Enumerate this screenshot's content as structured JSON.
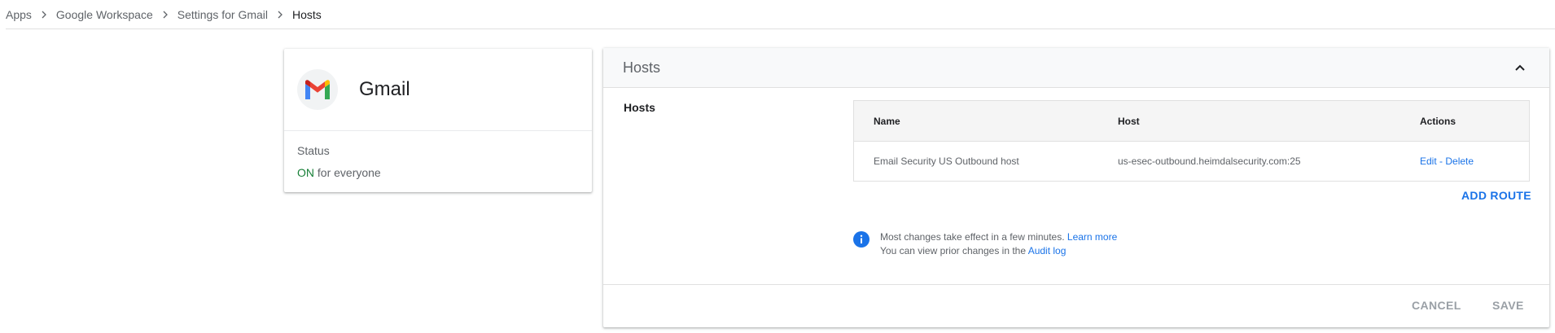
{
  "breadcrumb": {
    "items": [
      "Apps",
      "Google Workspace",
      "Settings for Gmail",
      "Hosts"
    ]
  },
  "app_card": {
    "name": "Gmail",
    "status_label": "Status",
    "status_on": "ON",
    "status_suffix": " for everyone",
    "logo_icon": "gmail-logo-icon",
    "status_color": "#188038"
  },
  "panel": {
    "title": "Hosts",
    "section_label": "Hosts",
    "table": {
      "headers": [
        "Name",
        "Host",
        "Actions"
      ],
      "rows": [
        {
          "name": "Email Security US Outbound host",
          "host": "us-esec-outbound.heimdalsecurity.com:25",
          "edit": "Edit",
          "sep": " - ",
          "delete": "Delete"
        }
      ]
    },
    "add_route_label": "ADD ROUTE",
    "info": {
      "line1_text": "Most changes take effect in a few minutes. ",
      "line1_link": "Learn more",
      "line2_text": "You can view prior changes in the ",
      "line2_link": "Audit log"
    },
    "footer": {
      "cancel_label": "CANCEL",
      "save_label": "SAVE"
    }
  },
  "colors": {
    "accent": "#1a73e8",
    "status_on": "#188038",
    "disabled": "#9aa0a6"
  }
}
